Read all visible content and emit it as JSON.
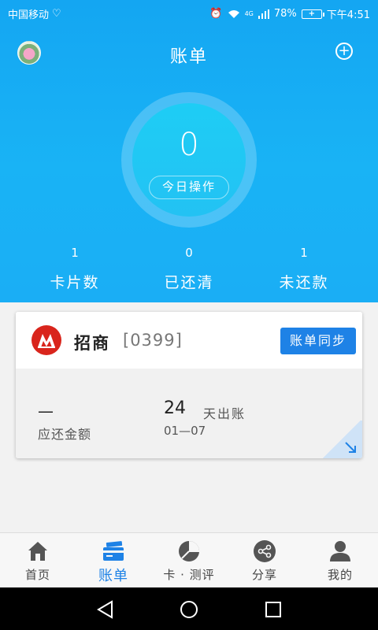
{
  "status": {
    "carrier": "中国移动",
    "battery": "78%",
    "time": "下午4:51",
    "network": "4G"
  },
  "header": {
    "title": "账单",
    "today_count": "0",
    "today_label": "今日操作"
  },
  "stats": [
    {
      "value": "1",
      "label": "卡片数"
    },
    {
      "value": "0",
      "label": "已还清"
    },
    {
      "value": "1",
      "label": "未还款"
    }
  ],
  "card": {
    "bank_name": "招商",
    "card_number": "[0399]",
    "sync_label": "账单同步",
    "amount_value": "—",
    "amount_label": "应还金额",
    "days_value": "24",
    "days_suffix": "天出账",
    "date": "01—07"
  },
  "tabs": [
    {
      "label": "首页",
      "icon": "home-icon"
    },
    {
      "label": "账单",
      "icon": "card-icon"
    },
    {
      "label": "卡 · 测评",
      "icon": "pie-chart-icon"
    },
    {
      "label": "分享",
      "icon": "share-icon"
    },
    {
      "label": "我的",
      "icon": "person-icon"
    }
  ],
  "colors": {
    "header_bg": "#19b3f5",
    "accent": "#1e82e6",
    "bank_red": "#d9251c"
  }
}
